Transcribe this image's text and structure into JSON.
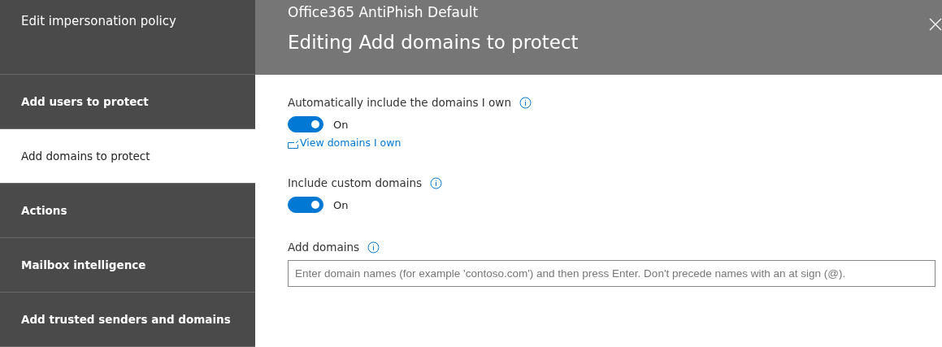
{
  "sidebar": {
    "heading": "Edit impersonation policy",
    "items": [
      {
        "label": "Add users to protect",
        "selected": false
      },
      {
        "label": "Add domains to protect",
        "selected": true
      },
      {
        "label": "Actions",
        "selected": false
      },
      {
        "label": "Mailbox intelligence",
        "selected": false
      },
      {
        "label": "Add trusted senders and domains",
        "selected": false
      }
    ]
  },
  "header": {
    "subtitle": "Office365 AntiPhish Default",
    "title": "Editing Add domains to protect"
  },
  "settings": [
    {
      "label": "Automatically include the domains I own",
      "on": true,
      "state_text": "On",
      "link": "View domains I own"
    },
    {
      "label": "Include custom domains",
      "on": true,
      "state_text": "On"
    }
  ],
  "add_domains": {
    "label": "Add domains",
    "placeholder": "Enter domain names (for example 'contoso.com') and then press Enter. Don't precede names with an at sign (@)."
  }
}
